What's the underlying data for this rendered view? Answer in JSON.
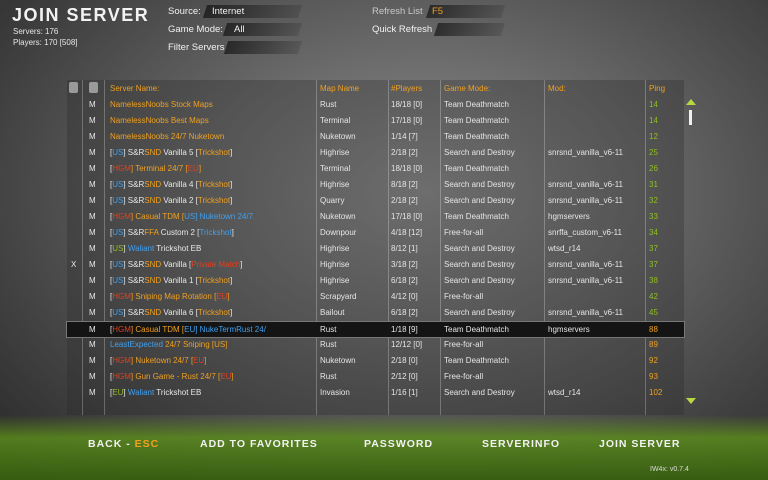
{
  "header": {
    "title": "JOIN SERVER",
    "servers_text": "Servers: 176",
    "players_text": "Players: 170 [508]"
  },
  "filters": {
    "source_label": "Source:",
    "source_value": "Internet",
    "game_mode_label": "Game Mode:",
    "game_mode_value": "All",
    "filter_servers_label": "Filter Servers",
    "refresh_label": "Refresh List",
    "refresh_key": "F5",
    "quick_refresh_label": "Quick Refresh"
  },
  "columns": {
    "server_name": "Server Name:",
    "map_name": "Map Name",
    "players": "#Players",
    "game_mode": "Game Mode:",
    "mod": "Mod:",
    "ping": "Ping"
  },
  "colors": {
    "accent_orange": "#f0a020",
    "tag_blue": "#3fa0f0",
    "tag_red": "#e04020",
    "ping_green": "#90c020"
  },
  "rows": [
    {
      "x": "",
      "m": "M",
      "name": [
        [
          "NamelessNoobs Stock Maps",
          "#f0a020"
        ]
      ],
      "map": "Rust",
      "players": "18/18 [0]",
      "mode": "Team Deathmatch",
      "mod": "",
      "ping": "14",
      "ping_color": "#90c020"
    },
    {
      "x": "",
      "m": "M",
      "name": [
        [
          "NamelessNoobs Best Maps",
          "#f0a020"
        ]
      ],
      "map": "Terminal",
      "players": "17/18 [0]",
      "mode": "Team Deathmatch",
      "mod": "",
      "ping": "14",
      "ping_color": "#90c020"
    },
    {
      "x": "",
      "m": "M",
      "name": [
        [
          "NamelessNoobs 24/7 Nuketown",
          "#f0a020"
        ]
      ],
      "map": "Nuketown",
      "players": "1/14 [7]",
      "mode": "Team Deathmatch",
      "mod": "",
      "ping": "12",
      "ping_color": "#90c020"
    },
    {
      "x": "",
      "m": "M",
      "name": [
        [
          "[",
          "#e8e8e8"
        ],
        [
          "US",
          "#3fa0f0"
        ],
        [
          "] S&R",
          "#e8e8e8"
        ],
        [
          "SND",
          "#f0a020"
        ],
        [
          " Vanilla 5 [",
          "#e8e8e8"
        ],
        [
          "Trickshot",
          "#f0a020"
        ],
        [
          "]",
          "#e8e8e8"
        ]
      ],
      "map": "Highrise",
      "players": "2/18 [2]",
      "mode": "Search and Destroy",
      "mod": "snrsnd_vanilla_v6-11",
      "ping": "25",
      "ping_color": "#90c020"
    },
    {
      "x": "",
      "m": "M",
      "name": [
        [
          "[",
          "#e8e8e8"
        ],
        [
          "HGM",
          "#e04020"
        ],
        [
          "] Terminal 24/7 [",
          "#f0a020"
        ],
        [
          "EU",
          "#e04020"
        ],
        [
          "]",
          "#f0a020"
        ]
      ],
      "map": "Terminal",
      "players": "18/18 [0]",
      "mode": "Team Deathmatch",
      "mod": "",
      "ping": "26",
      "ping_color": "#90c020"
    },
    {
      "x": "",
      "m": "M",
      "name": [
        [
          "[",
          "#e8e8e8"
        ],
        [
          "US",
          "#3fa0f0"
        ],
        [
          "] S&R",
          "#e8e8e8"
        ],
        [
          "SND",
          "#f0a020"
        ],
        [
          " Vanilla 4 [",
          "#e8e8e8"
        ],
        [
          "Trickshot",
          "#f0a020"
        ],
        [
          "]",
          "#e8e8e8"
        ]
      ],
      "map": "Highrise",
      "players": "8/18 [2]",
      "mode": "Search and Destroy",
      "mod": "snrsnd_vanilla_v6-11",
      "ping": "31",
      "ping_color": "#90c020"
    },
    {
      "x": "",
      "m": "M",
      "name": [
        [
          "[",
          "#e8e8e8"
        ],
        [
          "US",
          "#3fa0f0"
        ],
        [
          "] S&R",
          "#e8e8e8"
        ],
        [
          "SND",
          "#f0a020"
        ],
        [
          " Vanilla 2 [",
          "#e8e8e8"
        ],
        [
          "Trickshot",
          "#f0a020"
        ],
        [
          "]",
          "#e8e8e8"
        ]
      ],
      "map": "Quarry",
      "players": "2/18 [2]",
      "mode": "Search and Destroy",
      "mod": "snrsnd_vanilla_v6-11",
      "ping": "32",
      "ping_color": "#90c020"
    },
    {
      "x": "",
      "m": "M",
      "name": [
        [
          "[",
          "#e8e8e8"
        ],
        [
          "HGM",
          "#e04020"
        ],
        [
          "] Casual TDM [",
          "#f0a020"
        ],
        [
          "US",
          "#3fa0f0"
        ],
        [
          "] Nuketown 24/7",
          "#3fa0f0"
        ]
      ],
      "map": "Nuketown",
      "players": "17/18 [0]",
      "mode": "Team Deathmatch",
      "mod": "hgmservers",
      "ping": "33",
      "ping_color": "#90c020"
    },
    {
      "x": "",
      "m": "M",
      "name": [
        [
          "[",
          "#e8e8e8"
        ],
        [
          "US",
          "#3fa0f0"
        ],
        [
          "] S&R",
          "#e8e8e8"
        ],
        [
          "FFA",
          "#f0a020"
        ],
        [
          " Custom 2 [",
          "#e8e8e8"
        ],
        [
          "Trickshot",
          "#3fa0f0"
        ],
        [
          "]",
          "#e8e8e8"
        ]
      ],
      "map": "Downpour",
      "players": "4/18 [12]",
      "mode": "Free-for-all",
      "mod": "snrffa_custom_v6-11",
      "ping": "34",
      "ping_color": "#90c020"
    },
    {
      "x": "",
      "m": "M",
      "name": [
        [
          "[",
          "#e8e8e8"
        ],
        [
          "US",
          "#90c020"
        ],
        [
          "] ",
          "#e8e8e8"
        ],
        [
          "Waliant",
          "#3fa0f0"
        ],
        [
          " Trickshot EB",
          "#e8e8e8"
        ]
      ],
      "map": "Highrise",
      "players": "8/12 [1]",
      "mode": "Search and Destroy",
      "mod": "wtsd_r14",
      "ping": "37",
      "ping_color": "#90c020"
    },
    {
      "x": "X",
      "m": "M",
      "name": [
        [
          "[",
          "#e8e8e8"
        ],
        [
          "US",
          "#3fa0f0"
        ],
        [
          "] S&R",
          "#e8e8e8"
        ],
        [
          "SND",
          "#f0a020"
        ],
        [
          " Vanilla [",
          "#e8e8e8"
        ],
        [
          "Private Match",
          "#e04020"
        ],
        [
          "]",
          "#e8e8e8"
        ]
      ],
      "map": "Highrise",
      "players": "3/18 [2]",
      "mode": "Search and Destroy",
      "mod": "snrsnd_vanilla_v6-11",
      "ping": "37",
      "ping_color": "#90c020"
    },
    {
      "x": "",
      "m": "M",
      "name": [
        [
          "[",
          "#e8e8e8"
        ],
        [
          "US",
          "#3fa0f0"
        ],
        [
          "] S&R",
          "#e8e8e8"
        ],
        [
          "SND",
          "#f0a020"
        ],
        [
          " Vanilla 1 [",
          "#e8e8e8"
        ],
        [
          "Trickshot",
          "#f0a020"
        ],
        [
          "]",
          "#e8e8e8"
        ]
      ],
      "map": "Highrise",
      "players": "6/18 [2]",
      "mode": "Search and Destroy",
      "mod": "snrsnd_vanilla_v6-11",
      "ping": "38",
      "ping_color": "#90c020"
    },
    {
      "x": "",
      "m": "M",
      "name": [
        [
          "[",
          "#e8e8e8"
        ],
        [
          "HGM",
          "#e04020"
        ],
        [
          "] Sniping Map Rotation [",
          "#f0a020"
        ],
        [
          "EU",
          "#e04020"
        ],
        [
          "]",
          "#f0a020"
        ]
      ],
      "map": "Scrapyard",
      "players": "4/12 [0]",
      "mode": "Free-for-all",
      "mod": "",
      "ping": "42",
      "ping_color": "#90c020"
    },
    {
      "x": "",
      "m": "M",
      "name": [
        [
          "[",
          "#e8e8e8"
        ],
        [
          "US",
          "#3fa0f0"
        ],
        [
          "] S&R",
          "#e8e8e8"
        ],
        [
          "SND",
          "#f0a020"
        ],
        [
          " Vanilla 6 [",
          "#e8e8e8"
        ],
        [
          "Trickshot",
          "#f0a020"
        ],
        [
          "]",
          "#e8e8e8"
        ]
      ],
      "map": "Bailout",
      "players": "6/18 [2]",
      "mode": "Search and Destroy",
      "mod": "snrsnd_vanilla_v6-11",
      "ping": "45",
      "ping_color": "#90c020"
    },
    {
      "x": "",
      "m": "M",
      "selected": true,
      "name": [
        [
          "[",
          "#e8e8e8"
        ],
        [
          "HGM",
          "#e04020"
        ],
        [
          "] Casual TDM [",
          "#f0a020"
        ],
        [
          "EU",
          "#3fa0f0"
        ],
        [
          "] NukeTermRust 24/",
          "#3fa0f0"
        ]
      ],
      "map": "Rust",
      "players": "1/18 [9]",
      "mode": "Team Deathmatch",
      "mod": "hgmservers",
      "ping": "88",
      "ping_color": "#f0a020"
    },
    {
      "x": "",
      "m": "M",
      "name": [
        [
          "LeastExpected",
          "#3fa0f0"
        ],
        [
          " 24/7 Sniping [",
          "#f0a020"
        ],
        [
          "US",
          "#f0a020"
        ],
        [
          "]",
          "#f0a020"
        ]
      ],
      "map": "Rust",
      "players": "12/12 [0]",
      "mode": "Free-for-all",
      "mod": "",
      "ping": "89",
      "ping_color": "#f0a020"
    },
    {
      "x": "",
      "m": "M",
      "name": [
        [
          "[",
          "#e8e8e8"
        ],
        [
          "HGM",
          "#e04020"
        ],
        [
          "] Nuketown 24/7 [",
          "#f0a020"
        ],
        [
          "EU",
          "#e04020"
        ],
        [
          "]",
          "#f0a020"
        ]
      ],
      "map": "Nuketown",
      "players": "2/18 [0]",
      "mode": "Team Deathmatch",
      "mod": "",
      "ping": "92",
      "ping_color": "#f0a020"
    },
    {
      "x": "",
      "m": "M",
      "name": [
        [
          "[",
          "#e8e8e8"
        ],
        [
          "HGM",
          "#e04020"
        ],
        [
          "] Gun Game - Rust 24/7 [",
          "#f0a020"
        ],
        [
          "EU",
          "#e04020"
        ],
        [
          "]",
          "#f0a020"
        ]
      ],
      "map": "Rust",
      "players": "2/12 [0]",
      "mode": "Free-for-all",
      "mod": "",
      "ping": "93",
      "ping_color": "#f0a020"
    },
    {
      "x": "",
      "m": "M",
      "name": [
        [
          "[",
          "#e8e8e8"
        ],
        [
          "EU",
          "#90c020"
        ],
        [
          "] ",
          "#e8e8e8"
        ],
        [
          "Waliant",
          "#3fa0f0"
        ],
        [
          " Trickshot EB",
          "#e8e8e8"
        ]
      ],
      "map": "Invasion",
      "players": "1/16 [1]",
      "mode": "Search and Destroy",
      "mod": "wtsd_r14",
      "ping": "102",
      "ping_color": "#f0a020"
    }
  ],
  "actions": {
    "back_label": "BACK - ",
    "back_key": "ESC",
    "add_favorites_label": "ADD TO FAVORITES",
    "password_label": "PASSWORD",
    "serverinfo_label": "SERVERINFO",
    "join_server_label": "JOIN SERVER"
  },
  "version": "IW4x: v0.7.4"
}
